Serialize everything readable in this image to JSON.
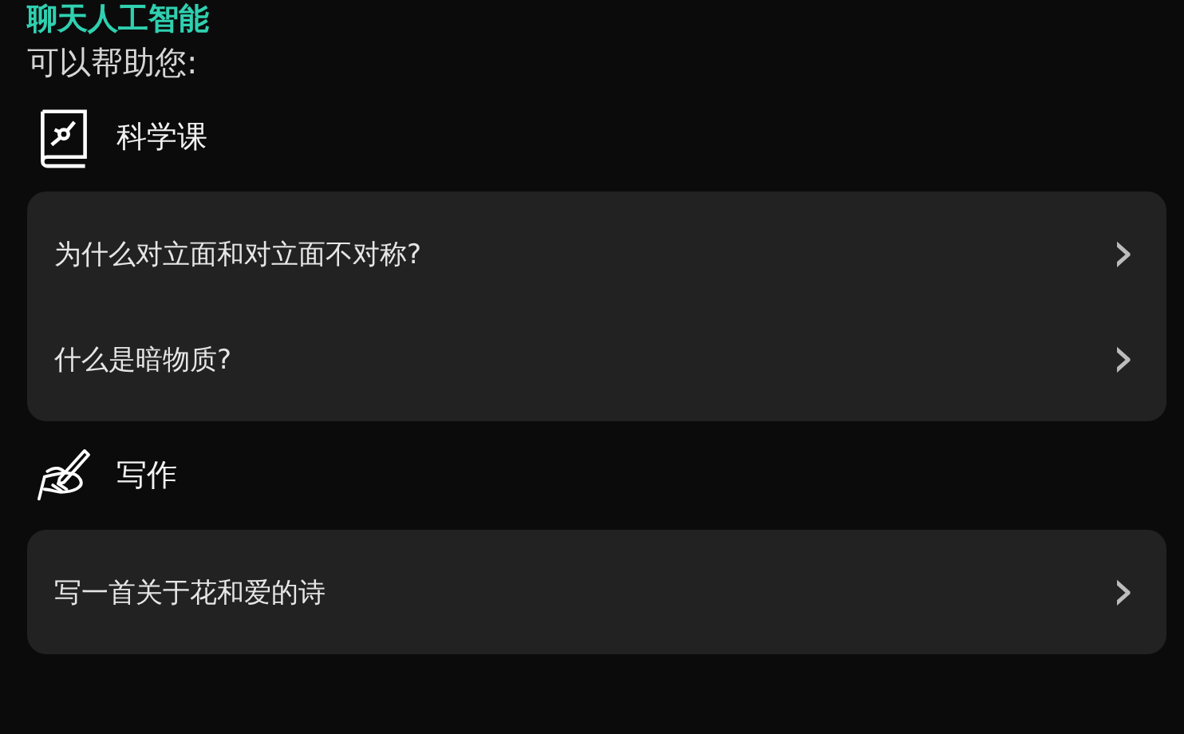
{
  "header": {
    "title": "聊天人工智能",
    "subtitle": "可以帮助您:"
  },
  "sections": [
    {
      "kind": "science",
      "title": "科学课",
      "items": [
        {
          "text": "为什么对立面和对立面不对称?",
          "chevron": "›"
        },
        {
          "text": "什么是暗物质?",
          "chevron": "›"
        }
      ]
    },
    {
      "kind": "writing",
      "title": "写作",
      "items": [
        {
          "text": "写一首关于花和爱的诗",
          "chevron": "›"
        }
      ]
    }
  ]
}
